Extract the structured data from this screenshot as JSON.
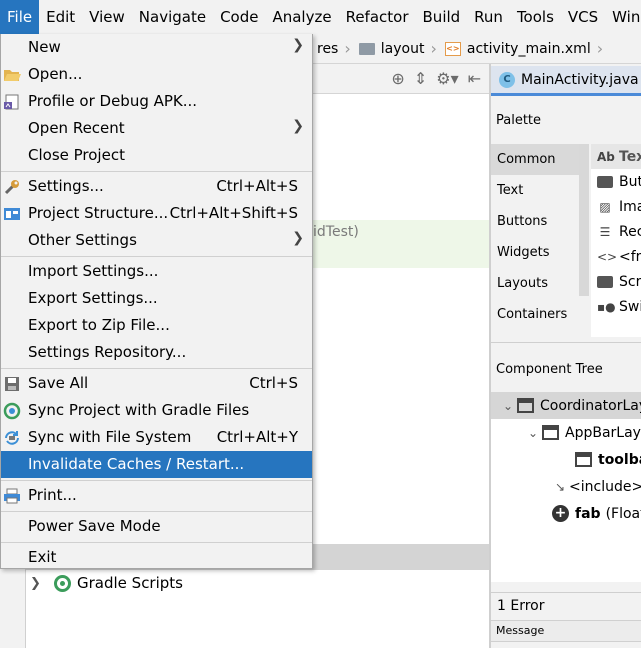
{
  "menubar": {
    "items": [
      {
        "label": "File",
        "active": true
      },
      {
        "label": "Edit"
      },
      {
        "label": "View"
      },
      {
        "label": "Navigate"
      },
      {
        "label": "Code"
      },
      {
        "label": "Analyze"
      },
      {
        "label": "Refactor"
      },
      {
        "label": "Build"
      },
      {
        "label": "Run"
      },
      {
        "label": "Tools"
      },
      {
        "label": "VCS"
      },
      {
        "label": "Window"
      }
    ]
  },
  "breadcrumb": {
    "res": "res",
    "layout": "layout",
    "file": "activity_main.xml"
  },
  "project": {
    "partial_text": "idTest)",
    "gradle_scripts": "Gradle Scripts"
  },
  "editor": {
    "tab_label": "MainActivity.java",
    "java_icon_letter": "C"
  },
  "palette": {
    "title": "Palette",
    "categories": [
      "Common",
      "Text",
      "Buttons",
      "Widgets",
      "Layouts",
      "Containers"
    ],
    "selected_category": "Common",
    "items": [
      {
        "label": "TextView",
        "icon": "text-ab-icon"
      },
      {
        "label": "Button",
        "icon": "button-icon"
      },
      {
        "label": "ImageView",
        "icon": "image-icon"
      },
      {
        "label": "RecyclerView",
        "icon": "list-icon"
      },
      {
        "label": "<fragment>",
        "icon": "code-icon"
      },
      {
        "label": "ScrollView",
        "icon": "scroll-icon"
      },
      {
        "label": "Switch",
        "icon": "switch-icon"
      }
    ],
    "header_icon_text": "Ab"
  },
  "component_tree": {
    "title": "Component Tree",
    "rows": [
      {
        "label": "CoordinatorLayout",
        "bold": false
      },
      {
        "label": "AppBarLayout",
        "bold": false
      },
      {
        "label": "toolbar",
        "bold": true
      },
      {
        "label": "<include>",
        "bold": false
      },
      {
        "label_bold": "fab",
        "label_rest": "(FloatingActionButton)"
      }
    ]
  },
  "errors": {
    "count_label": "1 Error",
    "message_header": "Message"
  },
  "file_menu": {
    "new": "New",
    "open": "Open...",
    "profile": "Profile or Debug APK...",
    "open_recent": "Open Recent",
    "close_project": "Close Project",
    "settings": "Settings...",
    "settings_sc": "Ctrl+Alt+S",
    "project_structure": "Project Structure...",
    "project_structure_sc": "Ctrl+Alt+Shift+S",
    "other_settings": "Other Settings",
    "import_settings": "Import Settings...",
    "export_settings": "Export Settings...",
    "export_zip": "Export to Zip File...",
    "settings_repo": "Settings Repository...",
    "save_all": "Save All",
    "save_all_sc": "Ctrl+S",
    "sync_gradle": "Sync Project with Gradle Files",
    "sync_fs": "Sync with File System",
    "sync_fs_sc": "Ctrl+Alt+Y",
    "invalidate": "Invalidate Caches / Restart...",
    "print": "Print...",
    "power_save": "Power Save Mode",
    "exit": "Exit"
  },
  "colors": {
    "highlight": "#2675bf",
    "menu_bg": "#f2f2f2"
  }
}
